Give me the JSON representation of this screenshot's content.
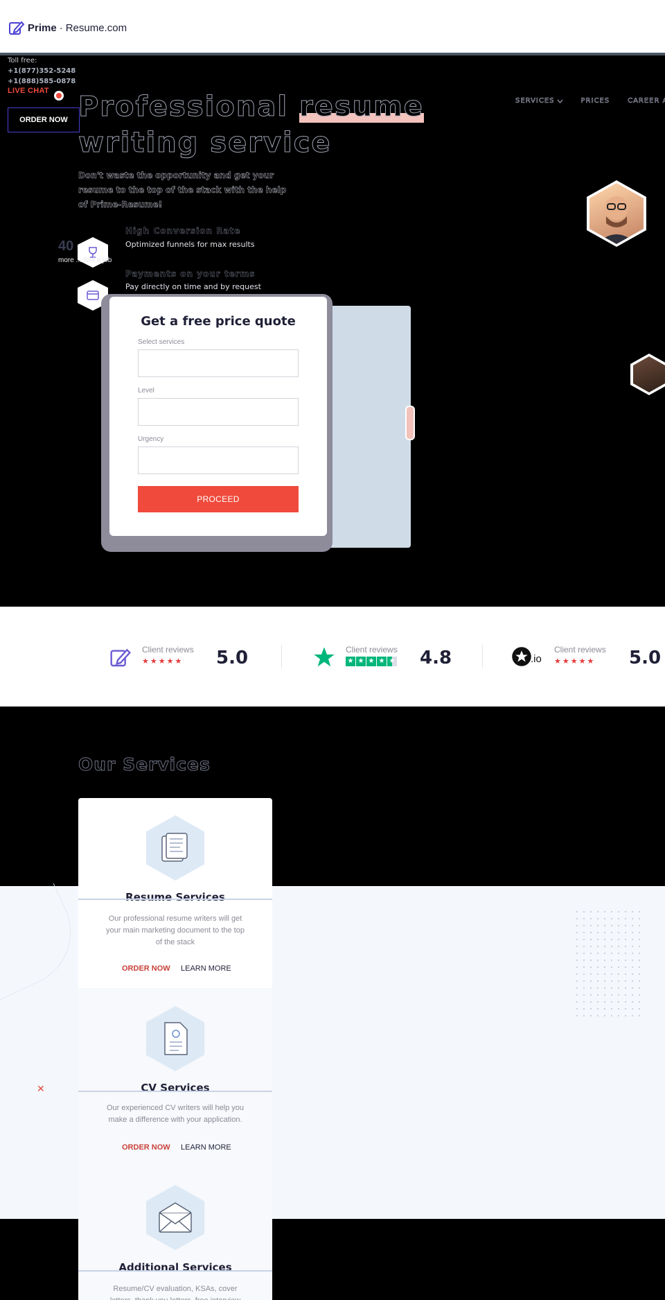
{
  "header": {
    "logo_prefix": "Prime",
    "logo_suffix": "Resume.com",
    "toll_free_label": "Toll free:",
    "phones": [
      "+1(877)352-5248",
      "+1(888)585-0878"
    ],
    "live_chat": "LIVE CHAT",
    "order_now": "ORDER NOW",
    "nav": [
      "SERVICES",
      "PRICES",
      "CAREER ADVICE"
    ]
  },
  "hero": {
    "title_part1": "Professional ",
    "title_highlight": "resume",
    "title_part2": "writing service",
    "subtitle": "Don't waste the opportunity and get your resume to the top of the stack with the help of Prime-Resume!",
    "features": [
      {
        "title": "High Conversion Rate",
        "desc": "Optimized funnels for max results"
      },
      {
        "title": "Payments on your terms",
        "desc": "Pay directly on time and by request"
      }
    ],
    "stat_number": "40",
    "stat_text": "more ... find a job"
  },
  "quote_form": {
    "title": "Get a free price quote",
    "fields": [
      {
        "label": "Select services",
        "value": ""
      },
      {
        "label": "Level",
        "value": ""
      },
      {
        "label": "Urgency",
        "value": ""
      }
    ],
    "button": "PROCEED"
  },
  "reviews": [
    {
      "label": "Client reviews",
      "score": "5.0",
      "icon": "prime-resume-pencil-icon",
      "stars": "★★★★★"
    },
    {
      "label": "Client reviews",
      "score": "4.8",
      "icon": "trustpilot-star-icon",
      "stars": "★★★★★"
    },
    {
      "label": "Client reviews",
      "score": "5.0",
      "icon": "reviews-io-icon",
      "stars": "★★★★★",
      "brand_suffix": ".io"
    }
  ],
  "services": {
    "title": "Our Services",
    "items": [
      {
        "name": "Resume Services",
        "desc": "Our professional resume writers will get your main marketing document to the top of the stack",
        "order": "ORDER NOW",
        "learn": "LEARN MORE",
        "icon": "documents-icon"
      },
      {
        "name": "CV Services",
        "desc": "Our experienced CV writers will help you make a difference with your application.",
        "order": "ORDER NOW",
        "learn": "LEARN MORE",
        "icon": "cv-document-icon"
      },
      {
        "name": "Additional Services",
        "desc": "Resume/CV evaluation, KSAs, cover letters, thank you letters, free interview",
        "icon": "envelope-icon"
      }
    ]
  },
  "colors": {
    "accent": "#ef4a3c",
    "brand": "#4b3fd2",
    "trustpilot": "#00b67a",
    "light_bg": "#f4f7fb"
  }
}
